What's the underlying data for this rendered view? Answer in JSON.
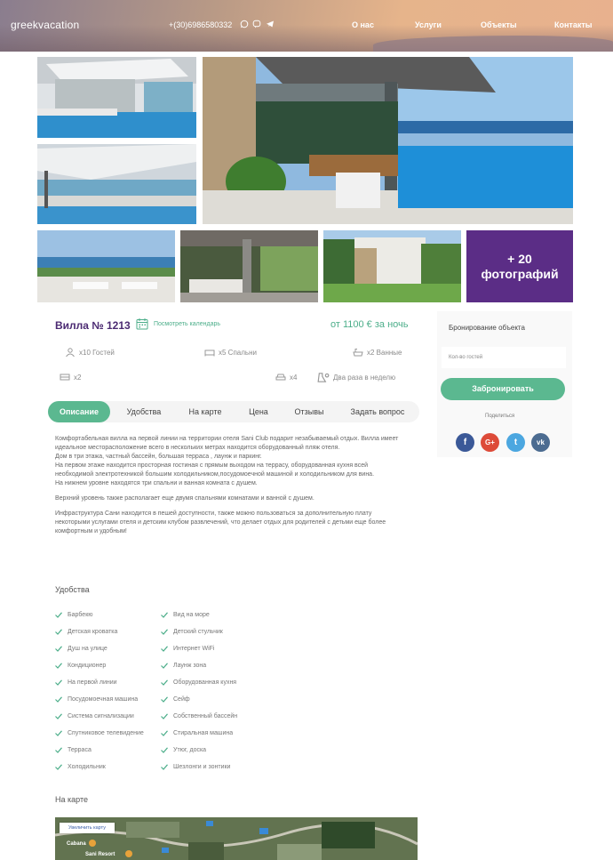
{
  "header": {
    "logo": "greekvacation",
    "phone": "+(30)6986580332",
    "nav": [
      "О нас",
      "Услуги",
      "Объекты",
      "Контакты"
    ]
  },
  "gallery": {
    "more_line1": "+ 20",
    "more_line2": "фотографий"
  },
  "listing": {
    "title": "Вилла № 1213",
    "calendar_link": "Посмотреть календарь",
    "price": "от 1100 € за ночь",
    "features": {
      "guests": "x10 Гостей",
      "bedrooms": "x5 Спальни",
      "bathrooms": "x2 Ванные",
      "beds": "x2",
      "parking": "x4",
      "cleaning": "Два раза в неделю"
    }
  },
  "tabs": [
    "Описание",
    "Удобства",
    "На карте",
    "Цена",
    "Отзывы",
    "Задать вопрос"
  ],
  "description": {
    "p1": [
      "Комфортабельная вилла на первой линии на территории отеля Sani Club подарит незабываемый отдых.  Вилла имеет",
      "идеальное месторасположение всего в нескольких метрах находится оборудованный пляж отеля.",
      "Дом в три этажа, частный бассейн, большая терраса , лаунж и паркинг.",
      "На первом этаже находится просторная гостиная с прямым выходом на террасу, оборудованная кухня всей",
      "необходимой электротехникой большим холодильником,посудомоечной машиной и холодильником для вина.",
      "На нижнем уровне находятся три спальни и ванная комната с душем."
    ],
    "p2": "Верхний уровень также  располагает еще двумя спальнями комнатами и ванной с душем.",
    "p3": [
      "Инфраструктура Сани находится в пешей доступности, также можно пользоваться за дополнительную плату",
      "некоторыми услугами отеля и детским клубом развлечений, что делает отдых для родителей с детьми еще более",
      "комфортным и удобным!"
    ]
  },
  "amenities": {
    "title": "Удобства",
    "left": [
      "Барбекю",
      "Детская кроватка",
      "Душ на улице",
      "Кондиционер",
      "На первой линии",
      "Посудомоечная машина",
      "Система сигнализации",
      "Спутниковое телевидение",
      "Терраса",
      "Холодильник"
    ],
    "right": [
      "Вид на море",
      "Детский стульчик",
      "Интернет WiFi",
      "Лаунж зона",
      "Оборудованная кухня",
      "Сейф",
      "Собственный бассейн",
      "Стиральная машина",
      "Утюг, доска",
      "Шезлонги и зонтики"
    ]
  },
  "map": {
    "title": "На карте",
    "enlarge": "Увеличить карту",
    "label1": "Cabana",
    "label2": "Sani Resort"
  },
  "booking": {
    "title": "Бронирование объекта",
    "guests_placeholder": "Кол-во гостей",
    "button": "Забронировать",
    "share": "Поделиться",
    "social": [
      "f",
      "G+",
      "t",
      "vk"
    ]
  },
  "colors": {
    "accent": "#5bb890",
    "purple": "#4b2a72",
    "more_bg": "#5b2d86"
  }
}
